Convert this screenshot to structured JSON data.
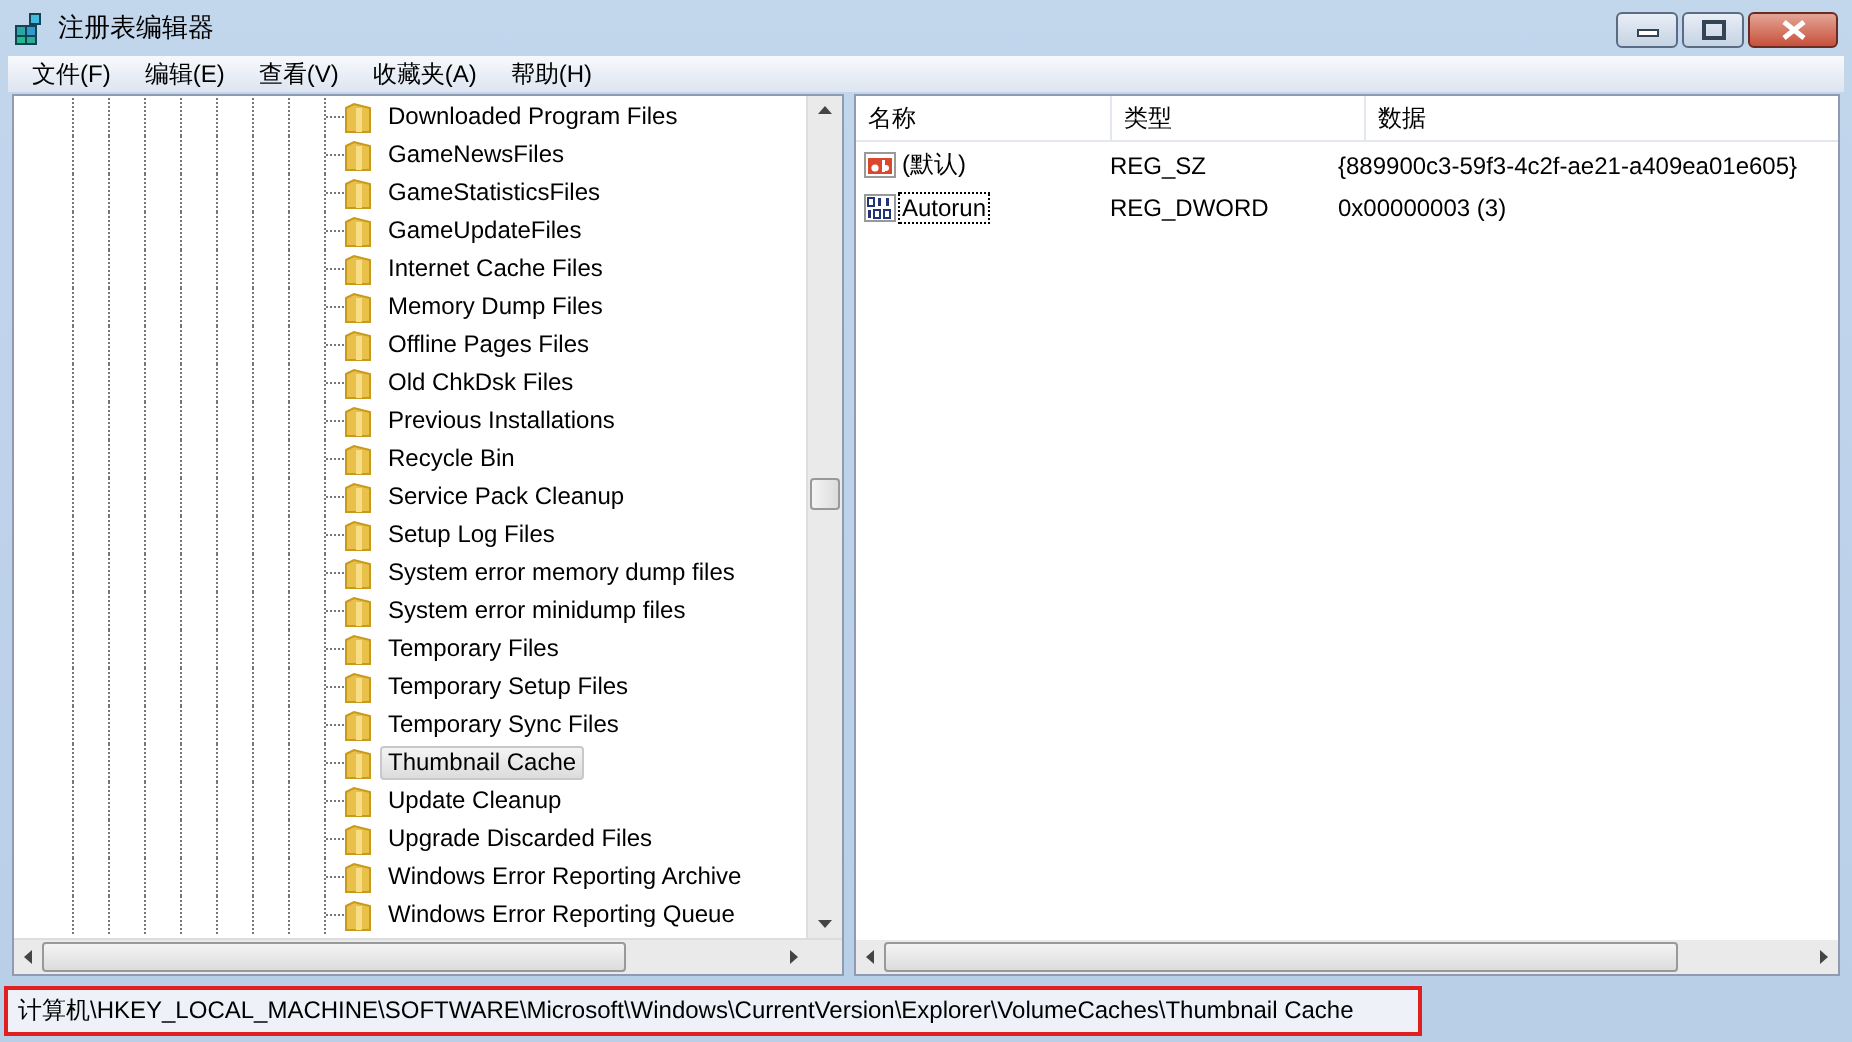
{
  "window": {
    "title": "注册表编辑器"
  },
  "menu": [
    "文件(F)",
    "编辑(E)",
    "查看(V)",
    "收藏夹(A)",
    "帮助(H)"
  ],
  "tree": {
    "items": [
      {
        "label": "Downloaded Program Files",
        "selected": false
      },
      {
        "label": "GameNewsFiles",
        "selected": false
      },
      {
        "label": "GameStatisticsFiles",
        "selected": false
      },
      {
        "label": "GameUpdateFiles",
        "selected": false
      },
      {
        "label": "Internet Cache Files",
        "selected": false
      },
      {
        "label": "Memory Dump Files",
        "selected": false
      },
      {
        "label": "Offline Pages Files",
        "selected": false
      },
      {
        "label": "Old ChkDsk Files",
        "selected": false
      },
      {
        "label": "Previous Installations",
        "selected": false
      },
      {
        "label": "Recycle Bin",
        "selected": false
      },
      {
        "label": "Service Pack Cleanup",
        "selected": false
      },
      {
        "label": "Setup Log Files",
        "selected": false
      },
      {
        "label": "System error memory dump files",
        "selected": false
      },
      {
        "label": "System error minidump files",
        "selected": false
      },
      {
        "label": "Temporary Files",
        "selected": false
      },
      {
        "label": "Temporary Setup Files",
        "selected": false
      },
      {
        "label": "Temporary Sync Files",
        "selected": false
      },
      {
        "label": "Thumbnail Cache",
        "selected": true
      },
      {
        "label": "Update Cleanup",
        "selected": false
      },
      {
        "label": "Upgrade Discarded Files",
        "selected": false
      },
      {
        "label": "Windows Error Reporting Archive",
        "selected": false
      },
      {
        "label": "Windows Error Reporting Queue",
        "selected": false
      }
    ]
  },
  "values_table": {
    "columns": [
      "名称",
      "类型",
      "数据"
    ],
    "rows": [
      {
        "kind": "string",
        "name": "(默认)",
        "type": "REG_SZ",
        "data": "{889900c3-59f3-4c2f-ae21-a409ea01e605}",
        "selected": false
      },
      {
        "kind": "binary",
        "name": "Autorun",
        "type": "REG_DWORD",
        "data": "0x00000003 (3)",
        "selected": true
      }
    ]
  },
  "status_bar": {
    "path": "计算机\\HKEY_LOCAL_MACHINE\\SOFTWARE\\Microsoft\\Windows\\CurrentVersion\\Explorer\\VolumeCaches\\Thumbnail Cache",
    "highlighted": true
  }
}
